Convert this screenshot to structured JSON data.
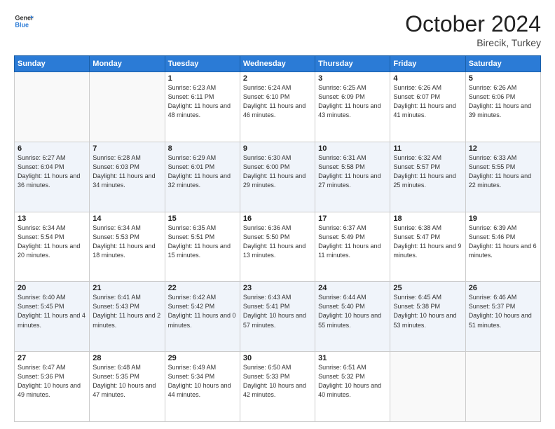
{
  "header": {
    "logo_general": "General",
    "logo_blue": "Blue",
    "month_title": "October 2024",
    "location": "Birecik, Turkey"
  },
  "weekdays": [
    "Sunday",
    "Monday",
    "Tuesday",
    "Wednesday",
    "Thursday",
    "Friday",
    "Saturday"
  ],
  "rows": [
    [
      {
        "day": "",
        "sunrise": "",
        "sunset": "",
        "daylight": "",
        "empty": true
      },
      {
        "day": "",
        "sunrise": "",
        "sunset": "",
        "daylight": "",
        "empty": true
      },
      {
        "day": "1",
        "sunrise": "Sunrise: 6:23 AM",
        "sunset": "Sunset: 6:11 PM",
        "daylight": "Daylight: 11 hours and 48 minutes.",
        "empty": false
      },
      {
        "day": "2",
        "sunrise": "Sunrise: 6:24 AM",
        "sunset": "Sunset: 6:10 PM",
        "daylight": "Daylight: 11 hours and 46 minutes.",
        "empty": false
      },
      {
        "day": "3",
        "sunrise": "Sunrise: 6:25 AM",
        "sunset": "Sunset: 6:09 PM",
        "daylight": "Daylight: 11 hours and 43 minutes.",
        "empty": false
      },
      {
        "day": "4",
        "sunrise": "Sunrise: 6:26 AM",
        "sunset": "Sunset: 6:07 PM",
        "daylight": "Daylight: 11 hours and 41 minutes.",
        "empty": false
      },
      {
        "day": "5",
        "sunrise": "Sunrise: 6:26 AM",
        "sunset": "Sunset: 6:06 PM",
        "daylight": "Daylight: 11 hours and 39 minutes.",
        "empty": false
      }
    ],
    [
      {
        "day": "6",
        "sunrise": "Sunrise: 6:27 AM",
        "sunset": "Sunset: 6:04 PM",
        "daylight": "Daylight: 11 hours and 36 minutes.",
        "empty": false
      },
      {
        "day": "7",
        "sunrise": "Sunrise: 6:28 AM",
        "sunset": "Sunset: 6:03 PM",
        "daylight": "Daylight: 11 hours and 34 minutes.",
        "empty": false
      },
      {
        "day": "8",
        "sunrise": "Sunrise: 6:29 AM",
        "sunset": "Sunset: 6:01 PM",
        "daylight": "Daylight: 11 hours and 32 minutes.",
        "empty": false
      },
      {
        "day": "9",
        "sunrise": "Sunrise: 6:30 AM",
        "sunset": "Sunset: 6:00 PM",
        "daylight": "Daylight: 11 hours and 29 minutes.",
        "empty": false
      },
      {
        "day": "10",
        "sunrise": "Sunrise: 6:31 AM",
        "sunset": "Sunset: 5:58 PM",
        "daylight": "Daylight: 11 hours and 27 minutes.",
        "empty": false
      },
      {
        "day": "11",
        "sunrise": "Sunrise: 6:32 AM",
        "sunset": "Sunset: 5:57 PM",
        "daylight": "Daylight: 11 hours and 25 minutes.",
        "empty": false
      },
      {
        "day": "12",
        "sunrise": "Sunrise: 6:33 AM",
        "sunset": "Sunset: 5:55 PM",
        "daylight": "Daylight: 11 hours and 22 minutes.",
        "empty": false
      }
    ],
    [
      {
        "day": "13",
        "sunrise": "Sunrise: 6:34 AM",
        "sunset": "Sunset: 5:54 PM",
        "daylight": "Daylight: 11 hours and 20 minutes.",
        "empty": false
      },
      {
        "day": "14",
        "sunrise": "Sunrise: 6:34 AM",
        "sunset": "Sunset: 5:53 PM",
        "daylight": "Daylight: 11 hours and 18 minutes.",
        "empty": false
      },
      {
        "day": "15",
        "sunrise": "Sunrise: 6:35 AM",
        "sunset": "Sunset: 5:51 PM",
        "daylight": "Daylight: 11 hours and 15 minutes.",
        "empty": false
      },
      {
        "day": "16",
        "sunrise": "Sunrise: 6:36 AM",
        "sunset": "Sunset: 5:50 PM",
        "daylight": "Daylight: 11 hours and 13 minutes.",
        "empty": false
      },
      {
        "day": "17",
        "sunrise": "Sunrise: 6:37 AM",
        "sunset": "Sunset: 5:49 PM",
        "daylight": "Daylight: 11 hours and 11 minutes.",
        "empty": false
      },
      {
        "day": "18",
        "sunrise": "Sunrise: 6:38 AM",
        "sunset": "Sunset: 5:47 PM",
        "daylight": "Daylight: 11 hours and 9 minutes.",
        "empty": false
      },
      {
        "day": "19",
        "sunrise": "Sunrise: 6:39 AM",
        "sunset": "Sunset: 5:46 PM",
        "daylight": "Daylight: 11 hours and 6 minutes.",
        "empty": false
      }
    ],
    [
      {
        "day": "20",
        "sunrise": "Sunrise: 6:40 AM",
        "sunset": "Sunset: 5:45 PM",
        "daylight": "Daylight: 11 hours and 4 minutes.",
        "empty": false
      },
      {
        "day": "21",
        "sunrise": "Sunrise: 6:41 AM",
        "sunset": "Sunset: 5:43 PM",
        "daylight": "Daylight: 11 hours and 2 minutes.",
        "empty": false
      },
      {
        "day": "22",
        "sunrise": "Sunrise: 6:42 AM",
        "sunset": "Sunset: 5:42 PM",
        "daylight": "Daylight: 11 hours and 0 minutes.",
        "empty": false
      },
      {
        "day": "23",
        "sunrise": "Sunrise: 6:43 AM",
        "sunset": "Sunset: 5:41 PM",
        "daylight": "Daylight: 10 hours and 57 minutes.",
        "empty": false
      },
      {
        "day": "24",
        "sunrise": "Sunrise: 6:44 AM",
        "sunset": "Sunset: 5:40 PM",
        "daylight": "Daylight: 10 hours and 55 minutes.",
        "empty": false
      },
      {
        "day": "25",
        "sunrise": "Sunrise: 6:45 AM",
        "sunset": "Sunset: 5:38 PM",
        "daylight": "Daylight: 10 hours and 53 minutes.",
        "empty": false
      },
      {
        "day": "26",
        "sunrise": "Sunrise: 6:46 AM",
        "sunset": "Sunset: 5:37 PM",
        "daylight": "Daylight: 10 hours and 51 minutes.",
        "empty": false
      }
    ],
    [
      {
        "day": "27",
        "sunrise": "Sunrise: 6:47 AM",
        "sunset": "Sunset: 5:36 PM",
        "daylight": "Daylight: 10 hours and 49 minutes.",
        "empty": false
      },
      {
        "day": "28",
        "sunrise": "Sunrise: 6:48 AM",
        "sunset": "Sunset: 5:35 PM",
        "daylight": "Daylight: 10 hours and 47 minutes.",
        "empty": false
      },
      {
        "day": "29",
        "sunrise": "Sunrise: 6:49 AM",
        "sunset": "Sunset: 5:34 PM",
        "daylight": "Daylight: 10 hours and 44 minutes.",
        "empty": false
      },
      {
        "day": "30",
        "sunrise": "Sunrise: 6:50 AM",
        "sunset": "Sunset: 5:33 PM",
        "daylight": "Daylight: 10 hours and 42 minutes.",
        "empty": false
      },
      {
        "day": "31",
        "sunrise": "Sunrise: 6:51 AM",
        "sunset": "Sunset: 5:32 PM",
        "daylight": "Daylight: 10 hours and 40 minutes.",
        "empty": false
      },
      {
        "day": "",
        "sunrise": "",
        "sunset": "",
        "daylight": "",
        "empty": true
      },
      {
        "day": "",
        "sunrise": "",
        "sunset": "",
        "daylight": "",
        "empty": true
      }
    ]
  ]
}
